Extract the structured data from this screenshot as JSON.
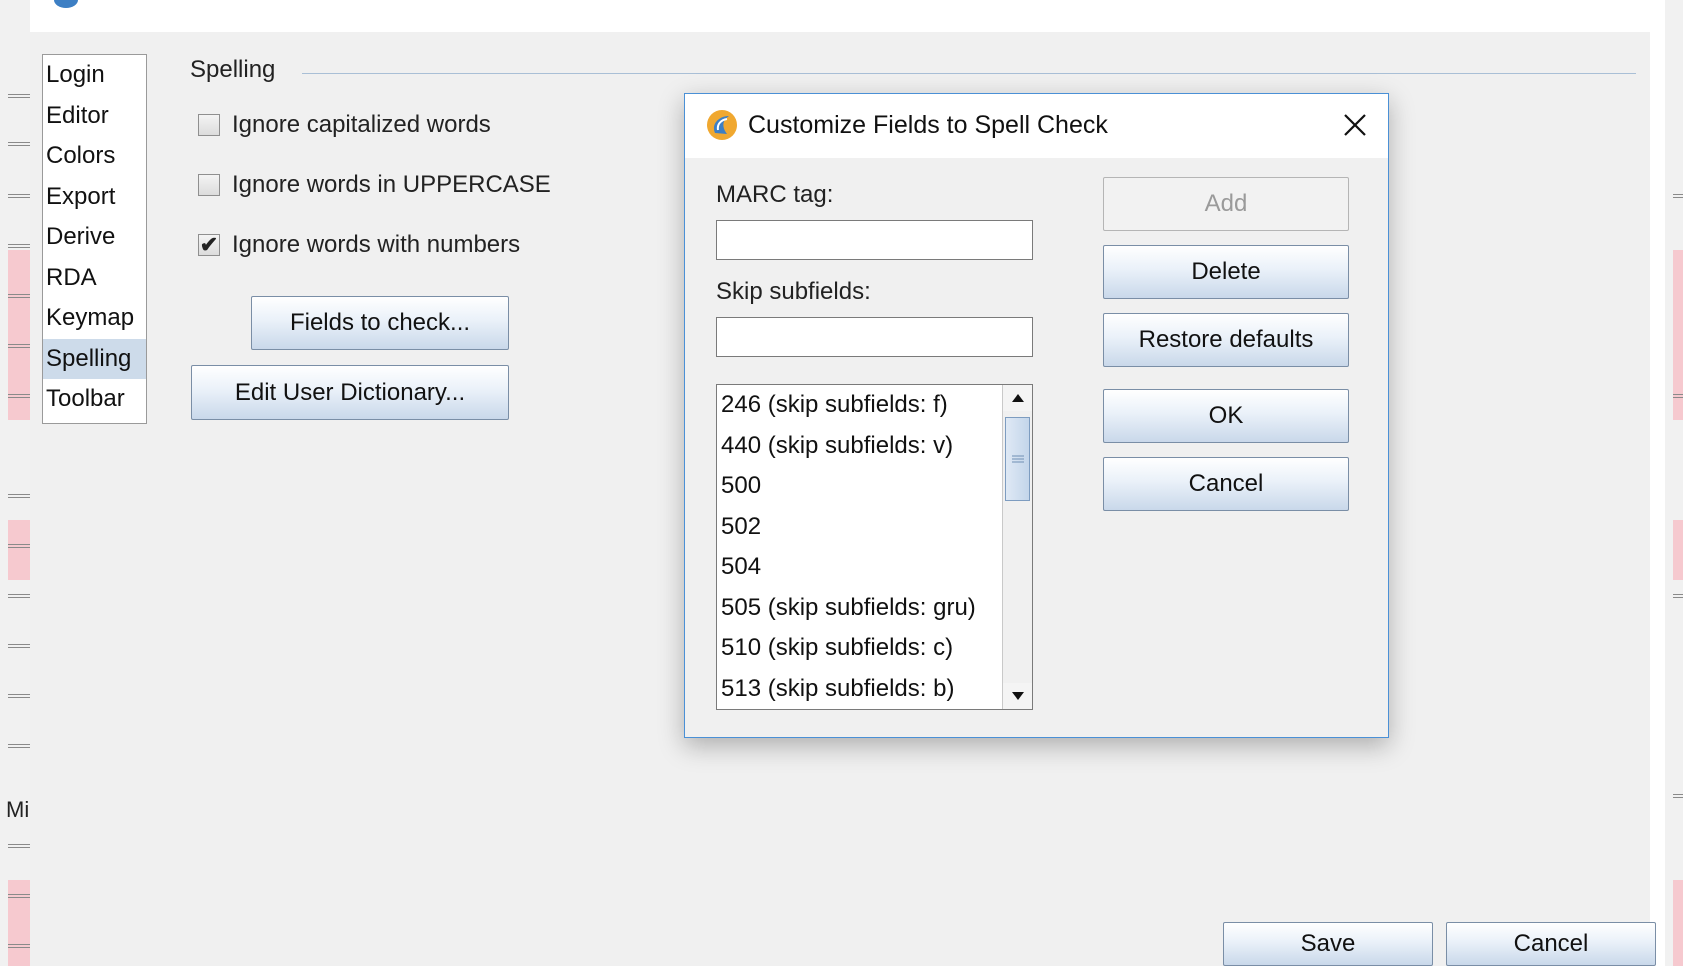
{
  "background": {
    "partial_label": "Mi"
  },
  "categories": [
    {
      "label": "Login",
      "selected": false
    },
    {
      "label": "Editor",
      "selected": false
    },
    {
      "label": "Colors",
      "selected": false
    },
    {
      "label": "Export",
      "selected": false
    },
    {
      "label": "Derive",
      "selected": false
    },
    {
      "label": "RDA",
      "selected": false
    },
    {
      "label": "Keymap",
      "selected": false
    },
    {
      "label": "Spelling",
      "selected": true
    },
    {
      "label": "Toolbar",
      "selected": false
    }
  ],
  "spelling": {
    "section_title": "Spelling",
    "options": [
      {
        "label": "Ignore capitalized words",
        "checked": false
      },
      {
        "label": "Ignore words in UPPERCASE",
        "checked": false
      },
      {
        "label": "Ignore words with numbers",
        "checked": true
      }
    ],
    "check_mark": "✔",
    "fields_button": "Fields to check...",
    "dictionary_button": "Edit User Dictionary..."
  },
  "footer": {
    "save_button": "Save",
    "cancel_button": "Cancel"
  },
  "dialog": {
    "title": "Customize Fields to Spell Check",
    "marc_tag_label": "MARC tag:",
    "marc_tag_value": "",
    "skip_subfields_label": "Skip subfields:",
    "skip_subfields_value": "",
    "fields": [
      "246 (skip subfields: f)",
      "440 (skip subfields: v)",
      "500",
      "502",
      "504",
      "505 (skip subfields: gru)",
      "510 (skip subfields: c)",
      "513 (skip subfields: b)"
    ],
    "buttons": {
      "add": "Add",
      "delete": "Delete",
      "restore_defaults": "Restore defaults",
      "ok": "OK",
      "cancel": "Cancel"
    }
  },
  "colors": {
    "dialog_border": "#4a90d6",
    "selected_item": "#cddbea",
    "button_gradient_bottom": "#c9d8ea",
    "stripe_pink": "#f6c9cf",
    "icon_orange": "#f0a830",
    "icon_blue": "#3d7fc4"
  }
}
